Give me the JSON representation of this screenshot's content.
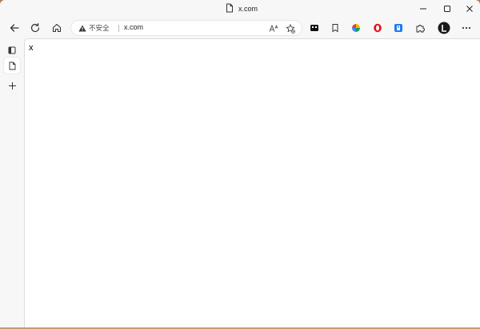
{
  "window": {
    "tab_title": "x.com"
  },
  "address_bar": {
    "security_label": "不安全",
    "url": "x.com"
  },
  "page": {
    "body_text": "x"
  },
  "icons": {
    "tab_favicon": "document-icon",
    "back": "arrow-left-icon",
    "refresh": "refresh-icon",
    "home": "home-icon",
    "warning": "warning-icon",
    "read_aloud": "read-aloud-icon",
    "favorite": "star-add-icon",
    "collections": "shield-badge-icon",
    "favorites_bar": "bookmark-icon",
    "ext_colorful": "extension-colorful-icon",
    "ext_opera": "opera-icon",
    "ext_blue": "blue-extension-icon",
    "extensions": "puzzle-icon",
    "profile": "profile-avatar-icon",
    "more": "more-icon",
    "sidebar_tabs": "tab-actions-icon",
    "sidebar_page": "page-icon",
    "sidebar_add": "plus-icon"
  },
  "colors": {
    "opera_red": "#e0101c",
    "blue_ext": "#1d7bf2"
  }
}
